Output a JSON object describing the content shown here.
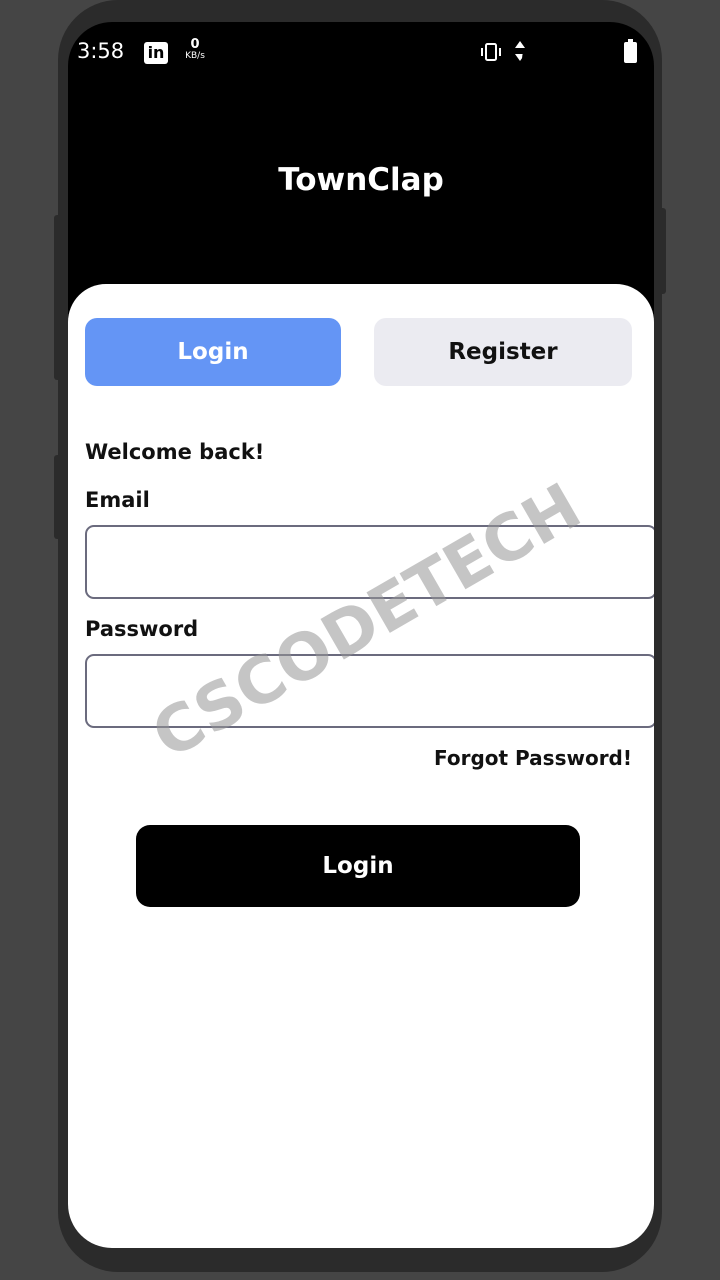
{
  "status_bar": {
    "time": "3:58",
    "app_icon": "linkedin-icon",
    "app_icon_text": "in",
    "net_speed_value": "0",
    "net_speed_unit": "KB/s"
  },
  "app": {
    "title": "TownClap"
  },
  "tabs": {
    "login_label": "Login",
    "register_label": "Register",
    "active": "Login"
  },
  "form": {
    "welcome": "Welcome back!",
    "email_label": "Email",
    "email_value": "",
    "password_label": "Password",
    "password_value": "",
    "forgot_label": "Forgot Password!",
    "submit_label": "Login"
  },
  "watermark": "CSCODETECH",
  "colors": {
    "active_tab": "#6495f5",
    "inactive_tab": "#ebebf1",
    "primary_button": "#000000"
  }
}
